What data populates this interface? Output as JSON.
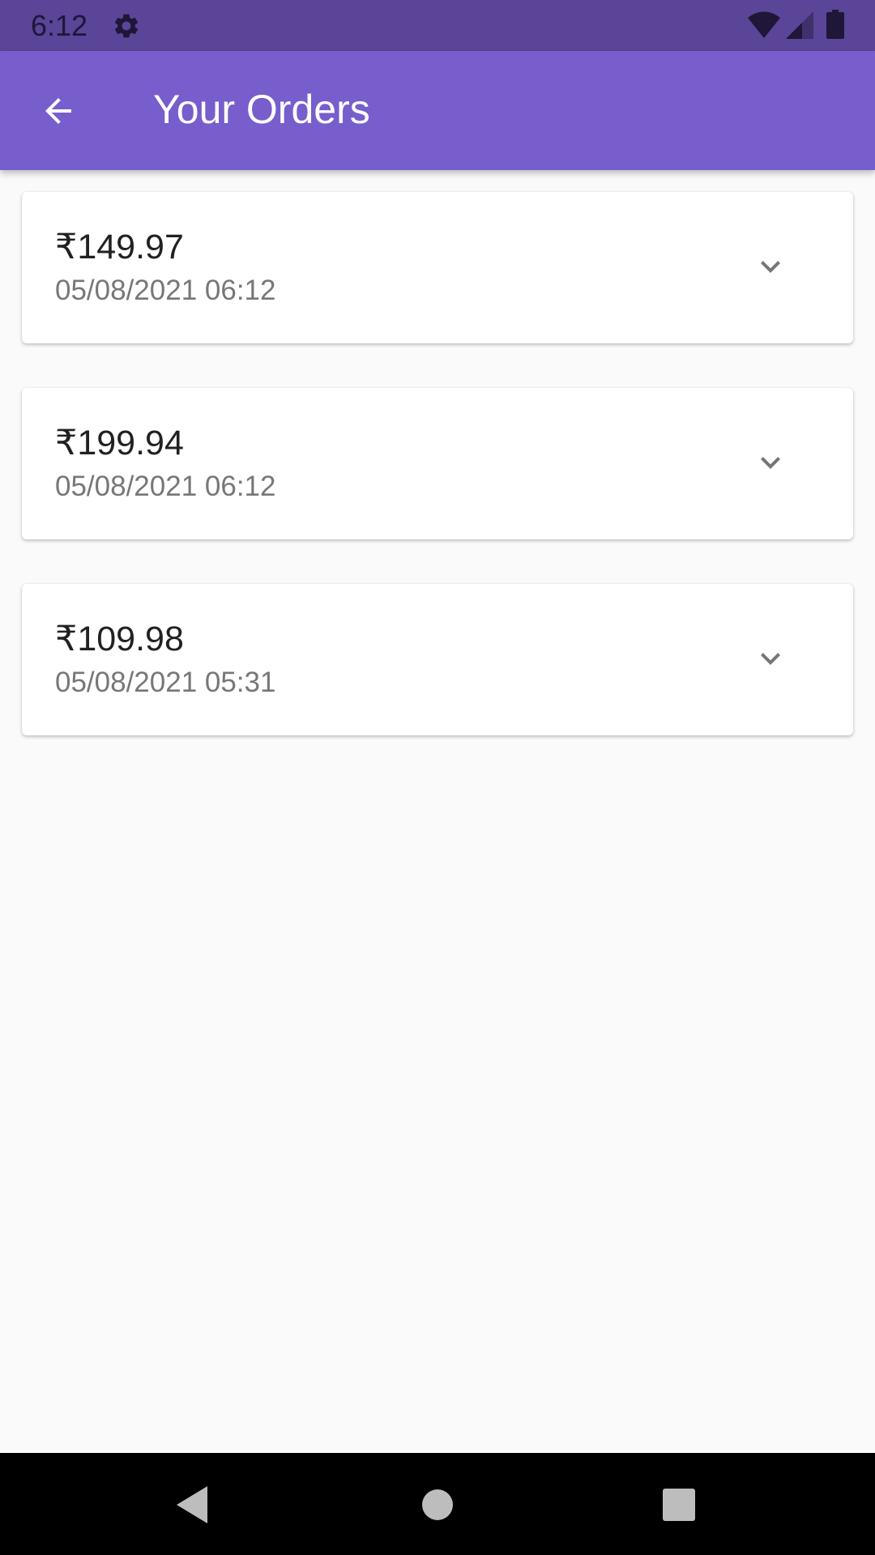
{
  "status_bar": {
    "time": "6:12",
    "icons": [
      "gear-icon",
      "wifi-icon",
      "signal-icon",
      "battery-icon"
    ]
  },
  "app_bar": {
    "title": "Your Orders",
    "back_icon": "arrow-back-icon",
    "color": "#785dcd"
  },
  "orders": [
    {
      "amount": "₹149.97",
      "date": "05/08/2021 06:12",
      "expand_icon": "chevron-down-icon"
    },
    {
      "amount": "₹199.94",
      "date": "05/08/2021 06:12",
      "expand_icon": "chevron-down-icon"
    },
    {
      "amount": "₹109.98",
      "date": "05/08/2021 05:31",
      "expand_icon": "chevron-down-icon"
    }
  ],
  "nav_bar": {
    "buttons": [
      "nav-back-icon",
      "nav-home-icon",
      "nav-recents-icon"
    ]
  }
}
